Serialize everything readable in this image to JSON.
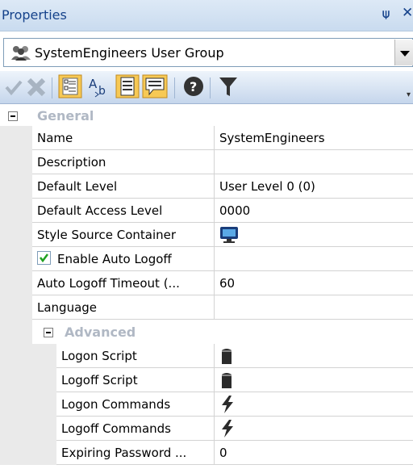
{
  "panel": {
    "title": "Properties",
    "pin_glyph": "⍦",
    "close_glyph": "✕"
  },
  "selector": {
    "value": "SystemEngineers User Group",
    "icon": "user-group-icon"
  },
  "toolbar": {
    "icons": [
      "check-icon",
      "delete-icon",
      "categorized-icon",
      "alphabetical-icon",
      "properties-icon",
      "events-icon",
      "help-icon",
      "filter-icon"
    ]
  },
  "categories": {
    "general": "General",
    "advanced": "Advanced"
  },
  "properties": [
    {
      "name": "Name",
      "value": "SystemEngineers"
    },
    {
      "name": "Description",
      "value": ""
    },
    {
      "name": "Default Level",
      "value": "User Level 0 (0)"
    },
    {
      "name": "Default Access Level",
      "value": "0000"
    },
    {
      "name": "Style Source Container",
      "value": "",
      "value_icon": "monitor-icon"
    },
    {
      "name": "Enable Auto Logoff",
      "value": "",
      "checked": true
    },
    {
      "name": "Auto Logoff Timeout (...",
      "value": "60"
    },
    {
      "name": "Language",
      "value": ""
    }
  ],
  "advanced_properties": [
    {
      "name": "Logon Script",
      "value": "",
      "value_icon": "script-icon"
    },
    {
      "name": "Logoff Script",
      "value": "",
      "value_icon": "script-icon"
    },
    {
      "name": "Logon Commands",
      "value": "",
      "value_icon": "lightning-icon"
    },
    {
      "name": "Logoff Commands",
      "value": "",
      "value_icon": "lightning-icon"
    },
    {
      "name": "Expiring Password ...",
      "value": "0"
    }
  ]
}
